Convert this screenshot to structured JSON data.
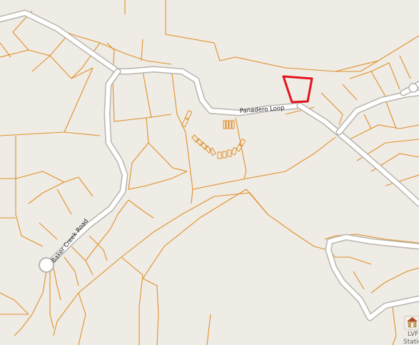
{
  "map": {
    "roads": [
      {
        "name": "Panadero Loop"
      },
      {
        "name": "Baker Creek Road"
      }
    ],
    "poi": {
      "label_line1": "LVF",
      "label_line2": "Station",
      "icon": "fire-station-icon"
    },
    "colors": {
      "background": "#efebe5",
      "parcel_line": "#e0922a",
      "road_fill": "#ffffff",
      "road_casing": "#b9b4ad",
      "highlight": "#e3131b"
    }
  }
}
